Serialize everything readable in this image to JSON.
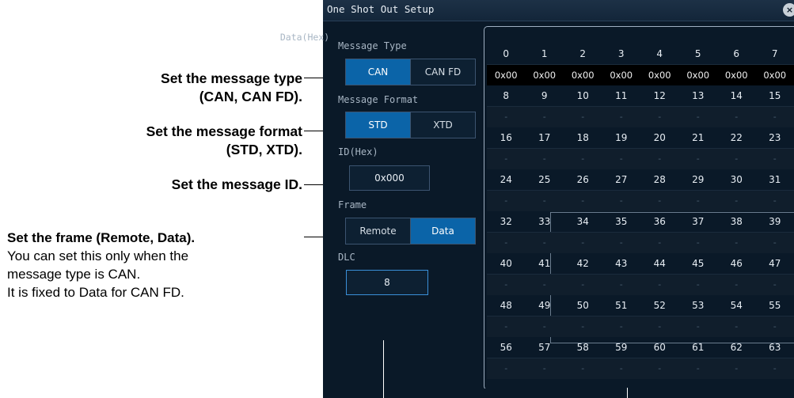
{
  "callouts": {
    "message_type": [
      "Set the message type",
      "(CAN, CAN FD)."
    ],
    "message_format": [
      "Set the message format",
      "(STD, XTD)."
    ],
    "message_id": "Set the message ID.",
    "frame_title": "Set the frame (Remote, Data).",
    "frame_note_1": "You can set this only when the",
    "frame_note_2": "message type is CAN.",
    "frame_note_3": "It is fixed to Data for CAN FD."
  },
  "window": {
    "title": "One Shot Out Setup",
    "close_glyph": "×"
  },
  "message_type": {
    "label": "Message Type",
    "options": [
      "CAN",
      "CAN FD"
    ],
    "selected": "CAN"
  },
  "message_format": {
    "label": "Message Format",
    "options": [
      "STD",
      "XTD"
    ],
    "selected": "STD"
  },
  "id": {
    "label": "ID(Hex)",
    "value": "0x000"
  },
  "frame": {
    "label": "Frame",
    "options": [
      "Remote",
      "Data"
    ],
    "selected": "Data"
  },
  "dlc": {
    "label": "DLC",
    "value": "8"
  },
  "data_grid": {
    "title": "Data(Hex)",
    "rows": [
      {
        "indices": [
          "0",
          "1",
          "2",
          "3",
          "4",
          "5",
          "6",
          "7"
        ],
        "values": [
          "0x00",
          "0x00",
          "0x00",
          "0x00",
          "0x00",
          "0x00",
          "0x00",
          "0x00"
        ]
      },
      {
        "indices": [
          "8",
          "9",
          "10",
          "11",
          "12",
          "13",
          "14",
          "15"
        ],
        "values": [
          "-",
          "-",
          "-",
          "-",
          "-",
          "-",
          "-",
          "-"
        ]
      },
      {
        "indices": [
          "16",
          "17",
          "18",
          "19",
          "20",
          "21",
          "22",
          "23"
        ],
        "values": [
          "-",
          "-",
          "-",
          "-",
          "-",
          "-",
          "-",
          "-"
        ]
      },
      {
        "indices": [
          "24",
          "25",
          "26",
          "27",
          "28",
          "29",
          "30",
          "31"
        ],
        "values": [
          "-",
          "-",
          "-",
          "-",
          "-",
          "-",
          "-",
          "-"
        ]
      },
      {
        "indices": [
          "32",
          "33",
          "34",
          "35",
          "36",
          "37",
          "38",
          "39"
        ],
        "values": [
          "-",
          "-",
          "-",
          "-",
          "-",
          "-",
          "-",
          "-"
        ]
      },
      {
        "indices": [
          "40",
          "41",
          "42",
          "43",
          "44",
          "45",
          "46",
          "47"
        ],
        "values": [
          "-",
          "-",
          "-",
          "-",
          "-",
          "-",
          "-",
          "-"
        ]
      },
      {
        "indices": [
          "48",
          "49",
          "50",
          "51",
          "52",
          "53",
          "54",
          "55"
        ],
        "values": [
          "-",
          "-",
          "-",
          "-",
          "-",
          "-",
          "-",
          "-"
        ]
      },
      {
        "indices": [
          "56",
          "57",
          "58",
          "59",
          "60",
          "61",
          "62",
          "63"
        ],
        "values": [
          "-",
          "-",
          "-",
          "-",
          "-",
          "-",
          "-",
          "-"
        ]
      }
    ]
  },
  "colors": {
    "panel_bg": "#0a1928",
    "active_blue": "#0b64a8",
    "active_value_row": "#000000"
  }
}
